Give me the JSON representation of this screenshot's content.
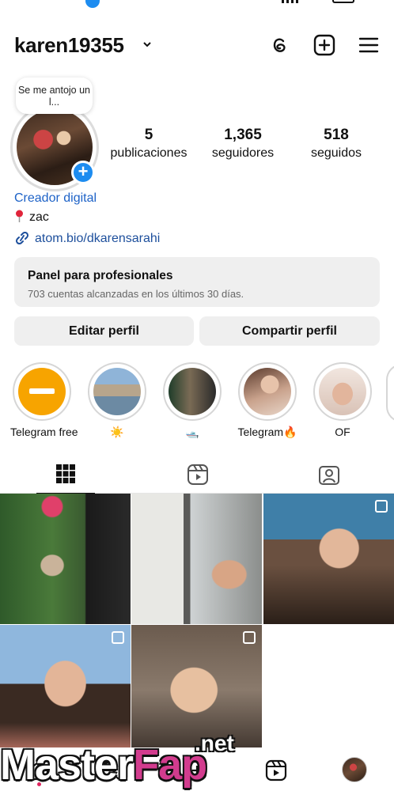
{
  "header": {
    "username": "karen19355"
  },
  "profile": {
    "note": "Se me antojo un l...",
    "stats": [
      {
        "value": "5",
        "label": "publicaciones"
      },
      {
        "value": "1,365",
        "label": "seguidores"
      },
      {
        "value": "518",
        "label": "seguidos"
      }
    ],
    "category": "Creador digital",
    "bio": "zac",
    "link": "atom.bio/dkarensarahi"
  },
  "panel": {
    "title": "Panel para profesionales",
    "subtitle": "703 cuentas alcanzadas en los últimos 30 días."
  },
  "buttons": {
    "edit": "Editar perfil",
    "share": "Compartir perfil"
  },
  "highlights": [
    {
      "label": "Telegram free"
    },
    {
      "label": "☀️"
    },
    {
      "label": "🛥️"
    },
    {
      "label": "Telegram🔥"
    },
    {
      "label": "OF"
    }
  ],
  "colors": {
    "accent": "#1d8cf0",
    "link": "#1d4f9c",
    "category": "#1d62c7"
  },
  "watermark": {
    "text_a": "Master",
    "text_b": "Fap",
    "text_c": ".net"
  }
}
